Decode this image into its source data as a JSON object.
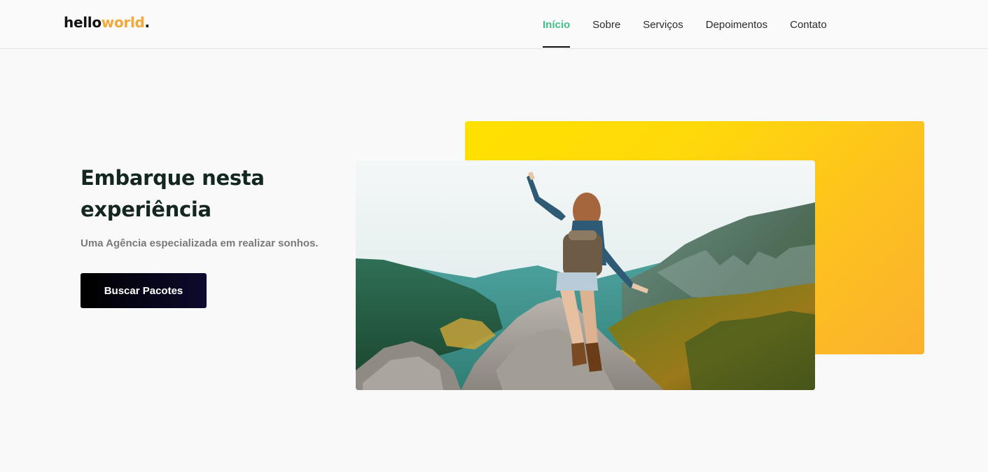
{
  "header": {
    "logo": {
      "part1": "hello",
      "part2": "world",
      "part3": "."
    },
    "nav": [
      {
        "label": "Início",
        "active": true
      },
      {
        "label": "Sobre",
        "active": false
      },
      {
        "label": "Serviços",
        "active": false
      },
      {
        "label": "Depoimentos",
        "active": false
      },
      {
        "label": "Contato",
        "active": false
      }
    ]
  },
  "hero": {
    "title": "Embarque nesta experiência",
    "subtitle": "Uma Agência especializada em realizar sonhos.",
    "button_label": "Buscar Pacotes"
  },
  "colors": {
    "accent_green": "#3fbf87",
    "logo_orange": "#f2a93b",
    "title_dark": "#13261f",
    "button_dark": "#0d0a2e",
    "card_yellow_start": "#ffe100",
    "card_yellow_end": "#fbb12e"
  }
}
